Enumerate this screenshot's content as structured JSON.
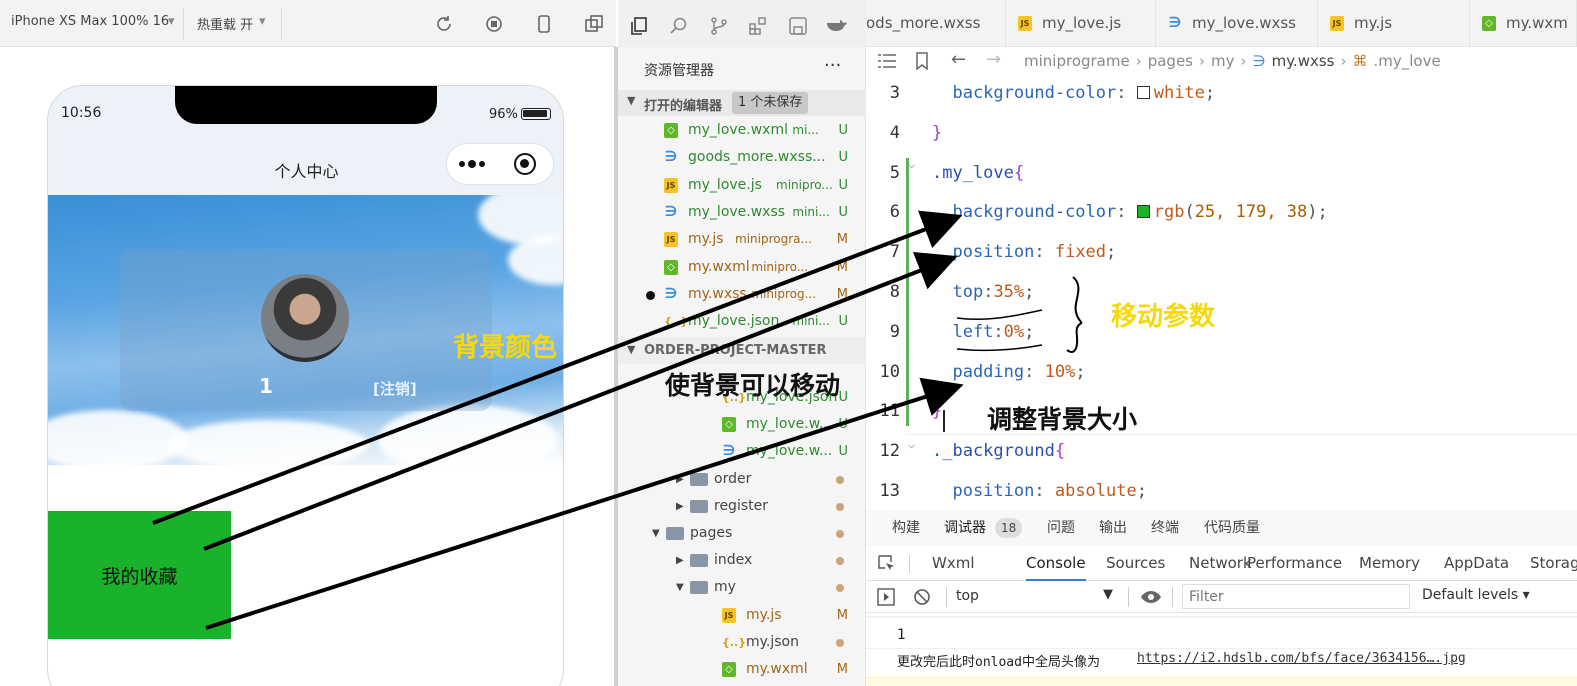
{
  "simulator": {
    "device_select": "iPhone XS Max 100% 16",
    "hot_reload": "热重载 开",
    "icons": [
      "refresh-icon",
      "stop-icon",
      "phone-icon",
      "multi-window-icon"
    ],
    "status": {
      "time": "10:56",
      "battery": "96%"
    },
    "nav_title": "个人中心",
    "profile": {
      "number": "1",
      "logout": "[注销]"
    },
    "favorite_label": "我的收藏"
  },
  "explorer": {
    "title": "资源管理器",
    "more": "···",
    "open_editors_label": "打开的编辑器",
    "unsaved_badge": "1 个未保存",
    "open_editors": [
      {
        "name": "my_love.wxml",
        "path": "mi...",
        "status": "U",
        "type": "wx"
      },
      {
        "name": "goods_more.wxss...",
        "path": "",
        "status": "U",
        "type": "css"
      },
      {
        "name": "my_love.js",
        "path": "minipro...",
        "status": "U",
        "type": "js"
      },
      {
        "name": "my_love.wxss",
        "path": "mini...",
        "status": "U",
        "type": "css"
      },
      {
        "name": "my.js",
        "path": "miniprogra...",
        "status": "M",
        "type": "js"
      },
      {
        "name": "my.wxml",
        "path": "minipro...",
        "status": "M",
        "type": "wx"
      },
      {
        "name": "my.wxss",
        "path": "miniprog...",
        "status": "M",
        "type": "css"
      },
      {
        "name": "my_love.json",
        "path": "mini...",
        "status": "U",
        "type": "json"
      }
    ],
    "project_label": "ORDER-PROJECT-MASTER",
    "tree": [
      {
        "name": "my_love.json",
        "status": "U",
        "type": "json",
        "indent": 2
      },
      {
        "name": "my_love.w...",
        "status": "U",
        "type": "wx",
        "indent": 2
      },
      {
        "name": "my_love.w...",
        "status": "U",
        "type": "css",
        "indent": 2
      },
      {
        "name": "order",
        "status": "",
        "type": "folder",
        "indent": 1
      },
      {
        "name": "register",
        "status": "",
        "type": "folder",
        "indent": 1
      },
      {
        "name": "pages",
        "status": "",
        "type": "folder-open",
        "indent": 0
      },
      {
        "name": "index",
        "status": "",
        "type": "folder",
        "indent": 1
      },
      {
        "name": "my",
        "status": "",
        "type": "folder-open",
        "indent": 1
      },
      {
        "name": "my.js",
        "status": "M",
        "type": "js",
        "indent": 2
      },
      {
        "name": "my.json",
        "status": "",
        "type": "json",
        "indent": 2
      },
      {
        "name": "my.wxml",
        "status": "M",
        "type": "wx",
        "indent": 2
      }
    ]
  },
  "editor": {
    "tabs": [
      {
        "label": "ods_more.wxss",
        "type": "none"
      },
      {
        "label": "my_love.js",
        "type": "js"
      },
      {
        "label": "my_love.wxss",
        "type": "css"
      },
      {
        "label": "my.js",
        "type": "js"
      },
      {
        "label": "my.wxm",
        "type": "wx"
      }
    ],
    "breadcrumb": [
      "miniprograme",
      "pages",
      "my",
      "my.wxss",
      ".my_love"
    ],
    "lines": [
      {
        "n": "3",
        "parts": [
          [
            "prop",
            "  background-color"
          ],
          [
            "pun",
            ": "
          ],
          [
            "swatch",
            "#ffffff"
          ],
          [
            "val",
            "white"
          ],
          [
            "pun",
            ";"
          ]
        ]
      },
      {
        "n": "4",
        "parts": [
          [
            "brace",
            "}"
          ]
        ]
      },
      {
        "n": "5",
        "parts": [
          [
            "sel",
            ".my_love"
          ],
          [
            "brace",
            "{"
          ]
        ]
      },
      {
        "n": "6",
        "parts": [
          [
            "prop",
            "  background-color"
          ],
          [
            "pun",
            ": "
          ],
          [
            "swatch",
            "#19b326"
          ],
          [
            "val",
            "rgb"
          ],
          [
            "pun",
            "("
          ],
          [
            "num",
            "25, 179, 38"
          ],
          [
            "pun",
            ");"
          ]
        ]
      },
      {
        "n": "7",
        "parts": [
          [
            "prop",
            "  position"
          ],
          [
            "pun",
            ": "
          ],
          [
            "val",
            "fixed"
          ],
          [
            "pun",
            ";"
          ]
        ]
      },
      {
        "n": "8",
        "parts": [
          [
            "prop",
            "  top"
          ],
          [
            "pun",
            ":"
          ],
          [
            "val",
            "35%"
          ],
          [
            "pun",
            ";"
          ]
        ]
      },
      {
        "n": "9",
        "parts": [
          [
            "prop",
            "  left"
          ],
          [
            "pun",
            ":"
          ],
          [
            "val",
            "0%"
          ],
          [
            "pun",
            ";"
          ]
        ]
      },
      {
        "n": "10",
        "parts": [
          [
            "prop",
            "  padding"
          ],
          [
            "pun",
            ": "
          ],
          [
            "val",
            "10%"
          ],
          [
            "pun",
            ";"
          ]
        ]
      },
      {
        "n": "11",
        "parts": [
          [
            "brace",
            "}"
          ]
        ]
      },
      {
        "n": "12",
        "parts": [
          [
            "sel",
            "._background"
          ],
          [
            "brace",
            "{"
          ]
        ]
      },
      {
        "n": "13",
        "parts": [
          [
            "prop",
            "  position"
          ],
          [
            "pun",
            ": "
          ],
          [
            "val",
            "absolute"
          ],
          [
            "pun",
            ";"
          ]
        ]
      }
    ]
  },
  "panel": {
    "tabs": [
      "构建",
      "调试器",
      "18",
      "问题",
      "输出",
      "终端",
      "代码质量"
    ],
    "dev_tabs": [
      "Wxml",
      "Console",
      "Sources",
      "Network",
      "Performance",
      "Memory",
      "AppData",
      "Storag"
    ],
    "console": {
      "context": "top",
      "filter_placeholder": "Filter",
      "levels": "Default levels ▾"
    },
    "log": [
      "1",
      "更改完后此时onload中全局头像为",
      "https://i2.hdslb.com/bfs/face/3634156….jpg"
    ]
  },
  "annotations": {
    "bg_color": "背景颜色",
    "movable": "使背景可以移动",
    "resize": "调整背景大小",
    "move_params": "移动参数"
  },
  "colors": {
    "green": "#1ab22a",
    "annotation_yellow": "#f5d90a",
    "accent": "#3b78d8"
  }
}
